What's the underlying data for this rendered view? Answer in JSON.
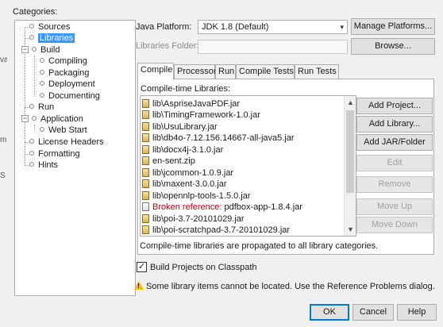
{
  "background_fragments": [
    "va",
    "m",
    "S"
  ],
  "categories": {
    "label": "Categories:",
    "items": [
      {
        "label": "Sources"
      },
      {
        "label": "Libraries"
      },
      {
        "label": "Build"
      },
      {
        "label": "Compiling"
      },
      {
        "label": "Packaging"
      },
      {
        "label": "Deployment"
      },
      {
        "label": "Documenting"
      },
      {
        "label": "Run"
      },
      {
        "label": "Application"
      },
      {
        "label": "Web Start"
      },
      {
        "label": "License Headers"
      },
      {
        "label": "Formatting"
      },
      {
        "label": "Hints"
      }
    ],
    "selected": "Libraries"
  },
  "java_platform": {
    "label": "Java Platform:",
    "value": "JDK 1.8 (Default)",
    "manage_button": "Manage Platforms..."
  },
  "libraries_folder": {
    "label": "Libraries Folder:",
    "value": "",
    "browse_button": "Browse..."
  },
  "tabs": [
    {
      "label": "Compile",
      "active": true
    },
    {
      "label": "Processor"
    },
    {
      "label": "Run"
    },
    {
      "label": "Compile Tests"
    },
    {
      "label": "Run Tests"
    }
  ],
  "compile": {
    "list_label": "Compile-time Libraries:",
    "libraries": [
      {
        "name": "lib\\AspriseJavaPDF.jar"
      },
      {
        "name": "lib\\TimingFramework-1.0.jar"
      },
      {
        "name": "lib\\UsuLibrary.jar"
      },
      {
        "name": "lib\\db4o-7.12.156.14667-all-java5.jar"
      },
      {
        "name": "lib\\docx4j-3.1.0.jar"
      },
      {
        "name": "en-sent.zip"
      },
      {
        "name": "lib\\jcommon-1.0.9.jar"
      },
      {
        "name": "lib\\maxent-3.0.0.jar"
      },
      {
        "name": "lib\\opennlp-tools-1.5.0.jar"
      },
      {
        "name": "pdfbox-app-1.8.4.jar",
        "broken_prefix": "Broken reference:"
      },
      {
        "name": "lib\\poi-3.7-20101029.jar"
      },
      {
        "name": "lib\\poi-scratchpad-3.7-20101029.jar"
      }
    ],
    "buttons": {
      "add_project": "Add Project...",
      "add_library": "Add Library...",
      "add_jar": "Add JAR/Folder",
      "edit": "Edit",
      "remove": "Remove",
      "move_up": "Move Up",
      "move_down": "Move Down"
    },
    "propagation_note": "Compile-time libraries are propagated to all library categories."
  },
  "build_on_classpath": {
    "label": "Build Projects on Classpath",
    "checked": true,
    "mark": "✓"
  },
  "warning": "Some library items cannot be located. Use the Reference Problems dialog.",
  "footer": {
    "ok": "OK",
    "cancel": "Cancel",
    "help": "Help"
  },
  "glyphs": {
    "dropdown": "▾",
    "scroll_up": "▲",
    "scroll_down": "▼",
    "minus": "−",
    "warning": "!"
  },
  "colors": {
    "selection": "#3399ff",
    "broken": "#c00000",
    "warning": "#f2c200"
  }
}
